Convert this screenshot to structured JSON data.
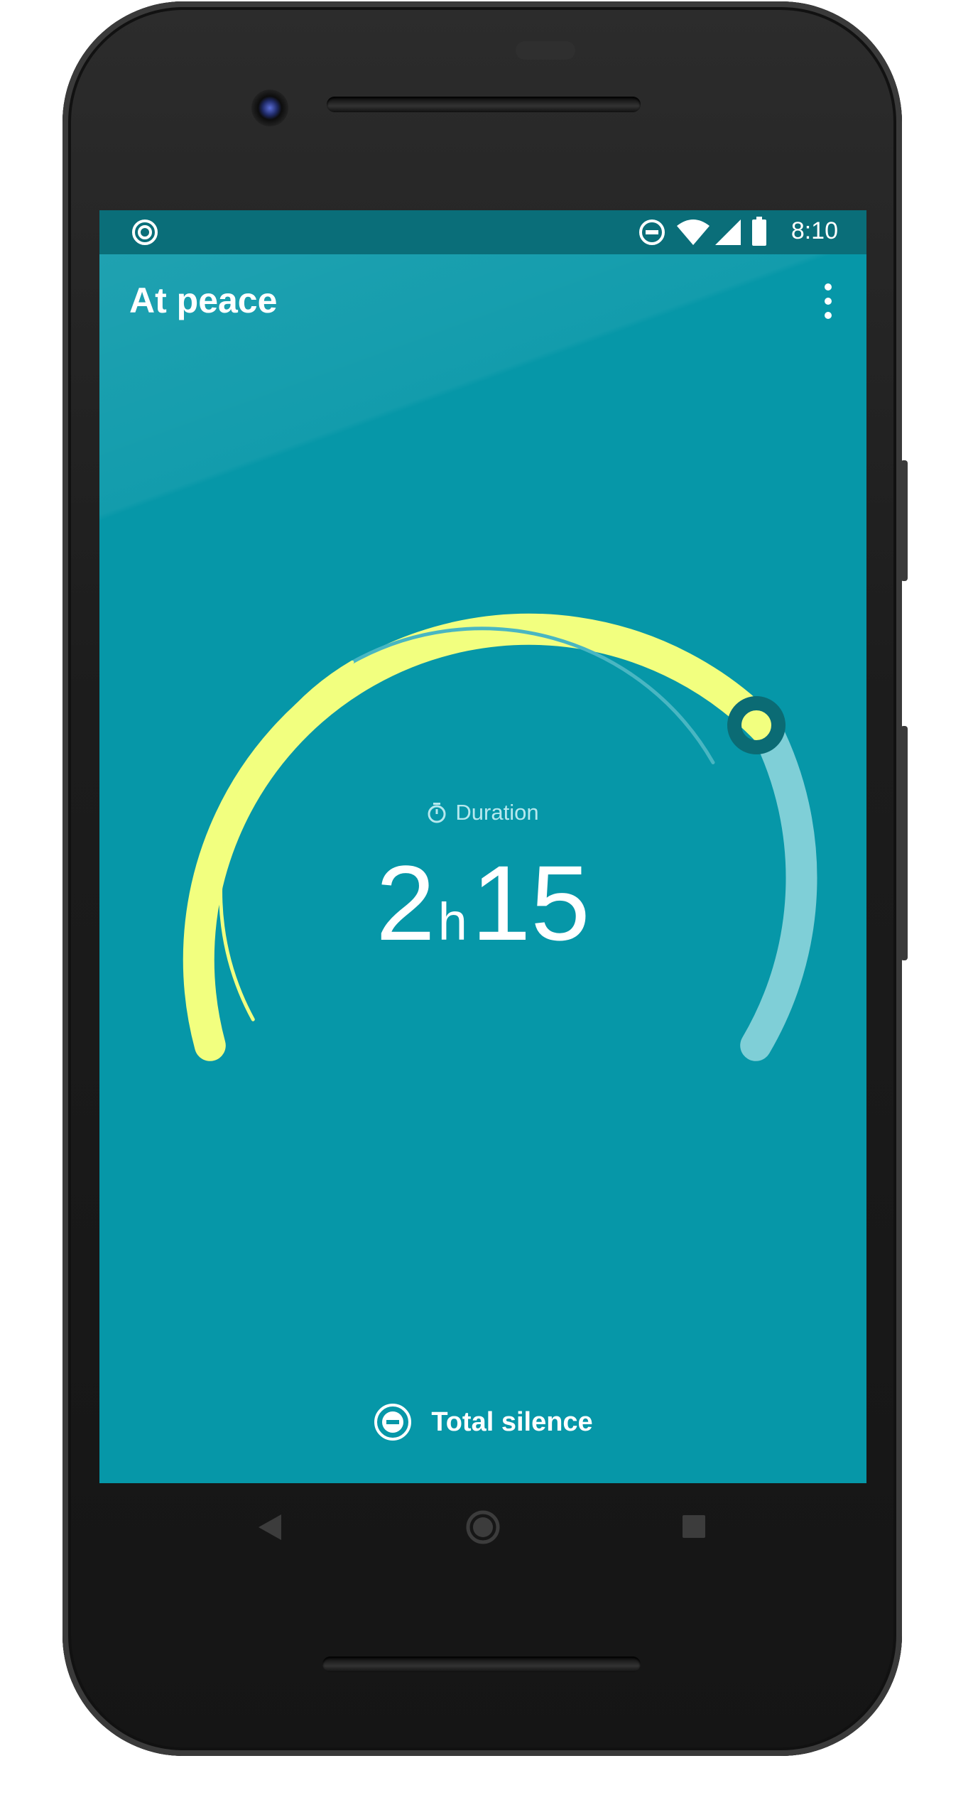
{
  "status_bar": {
    "left_icon": "notification-ring-icon",
    "right_icons": [
      "do-not-disturb-icon",
      "wifi-icon",
      "cell-signal-icon",
      "battery-icon"
    ],
    "time": "8:10"
  },
  "app_bar": {
    "title": "At peace",
    "menu_icon": "more-vert-icon"
  },
  "dial": {
    "label": "Duration",
    "label_icon": "timer-icon",
    "hours": "2",
    "hours_unit": "h",
    "minutes": "15",
    "fill_fraction": 0.82
  },
  "bottom_action": {
    "icon": "do-not-disturb-icon",
    "label": "Total silence"
  },
  "nav_bar": {
    "icons": [
      "back-icon",
      "home-icon",
      "recents-icon"
    ]
  },
  "colors": {
    "background": "#0697a8",
    "status_bar": "#0a6e79",
    "accent": "#f2ff7f",
    "track": "#7fcfd7",
    "handle": "#0b6b74",
    "inner_track": "#49b6c2"
  }
}
